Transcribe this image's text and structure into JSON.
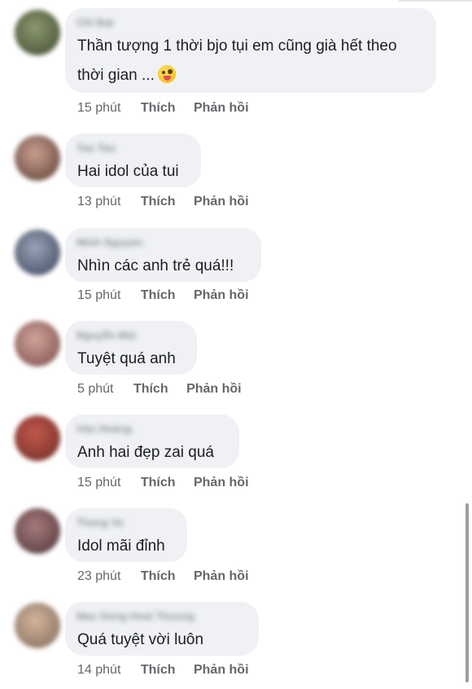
{
  "comments": [
    {
      "name": "Chi Đạt",
      "text_lines": [
        "Thần tượng 1 thời bjo tụi em cũng già hết theo",
        "thời gian ..."
      ],
      "emoji": "zany-face-icon",
      "time": "15 phút",
      "like": "Thích",
      "reply": "Phản hồi",
      "avatar_colors": [
        "#6d7a55",
        "#3f4a2e"
      ]
    },
    {
      "name": "Tao Tao",
      "text_lines": [
        "Hai idol của tui"
      ],
      "time": "13 phút",
      "like": "Thích",
      "reply": "Phản hồi",
      "avatar_colors": [
        "#b08a78",
        "#5a3a32"
      ]
    },
    {
      "name": "Minh Nguyen",
      "text_lines": [
        "Nhìn các anh trẻ quá!!!"
      ],
      "time": "15 phút",
      "like": "Thích",
      "reply": "Phản hồi",
      "avatar_colors": [
        "#8a94a8",
        "#3b4258"
      ]
    },
    {
      "name": "Nguyễn Mai",
      "text_lines": [
        "Tuyệt quá anh"
      ],
      "time": "5 phút",
      "like": "Thích",
      "reply": "Phản hồi",
      "avatar_colors": [
        "#c2948a",
        "#7a4a48"
      ]
    },
    {
      "name": "Văn Hoàng",
      "text_lines": [
        "Anh hai đẹp zai quá"
      ],
      "time": "15 phút",
      "like": "Thích",
      "reply": "Phản hồi",
      "avatar_colors": [
        "#b34a3e",
        "#6e2c28"
      ]
    },
    {
      "name": "Thang Vo",
      "text_lines": [
        "Idol mãi đỉnh"
      ],
      "time": "23 phút",
      "like": "Thích",
      "reply": "Phản hồi",
      "avatar_colors": [
        "#9a6e70",
        "#4a3438"
      ]
    },
    {
      "name": "Mac Dong Hoai Thuong",
      "text_lines": [
        "Quá tuyệt vời luôn"
      ],
      "time": "14 phút",
      "like": "Thích",
      "reply": "Phản hồi",
      "avatar_colors": [
        "#c9a890",
        "#7d6a58"
      ]
    }
  ]
}
